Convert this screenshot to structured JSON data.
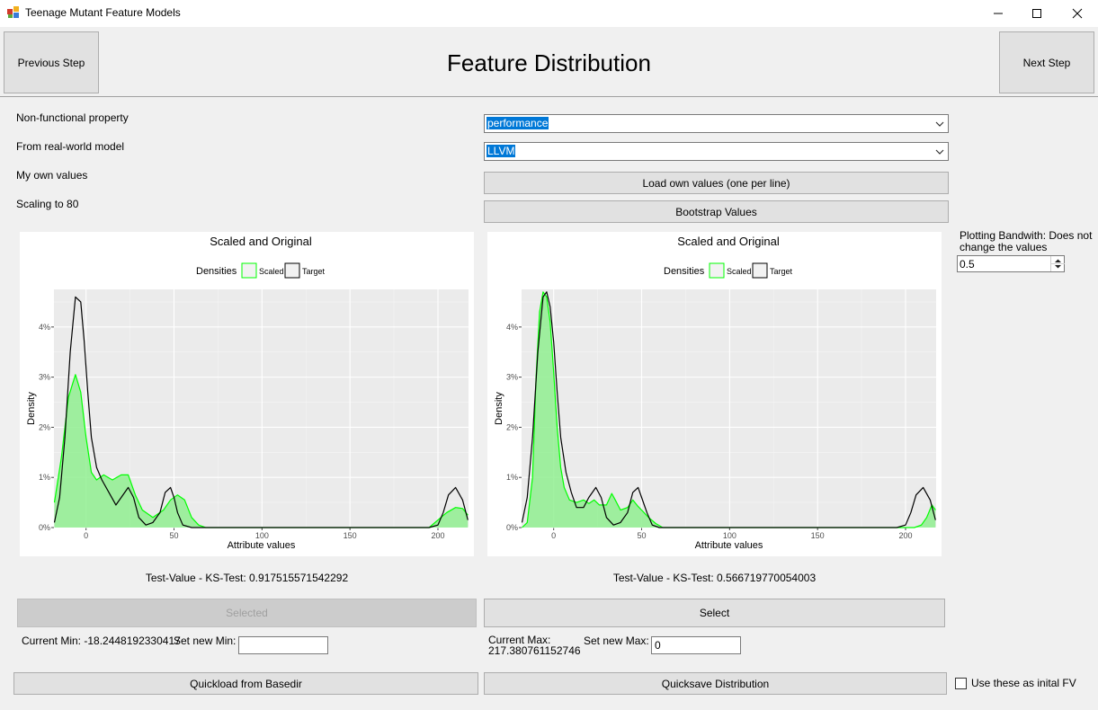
{
  "window": {
    "title": "Teenage Mutant Feature Models"
  },
  "header": {
    "title": "Feature Distribution",
    "prev_label": "Previous Step",
    "next_label": "Next Step"
  },
  "form": {
    "nfp_label": "Non-functional property",
    "nfp_value": "performance",
    "model_label": "From real-world model",
    "model_value": "LLVM",
    "own_values_label": "My own values",
    "load_button": "Load own values (one per line)",
    "scaling_label": "Scaling to 80",
    "bootstrap_button": "Bootstrap Values",
    "bandwidth_label_line1": "Plotting Bandwith: Does not",
    "bandwidth_label_line2": "change the values",
    "bandwidth_value": "0.5"
  },
  "left_panel": {
    "ks_text": "Test-Value - KS-Test: 0.917515571542292",
    "select_label": "Selected",
    "current_min": "Current Min: -18.2448192330417",
    "set_min_label": "Set new Min:",
    "set_min_value": "",
    "quickload": "Quickload from Basedir"
  },
  "right_panel": {
    "ks_text": "Test-Value - KS-Test: 0.566719770054003",
    "select_label": "Select",
    "current_max_line1": "Current Max:",
    "current_max_line2": "217.380761152746",
    "set_max_label": "Set new Max:",
    "set_max_value": "0",
    "quicksave": "Quicksave Distribution"
  },
  "use_initial": {
    "label": "Use these as inital FV",
    "checked": false
  },
  "colors": {
    "scaled_fill": "#90ee90",
    "scaled_line": "#00ff00",
    "target_line": "#000000",
    "plot_bg": "#ebebeb"
  },
  "chart_data": [
    {
      "type": "area",
      "title": "Scaled and Original",
      "legend_title": "Densities",
      "legend": [
        "Scaled",
        "Target"
      ],
      "xlabel": "Attribute values",
      "ylabel": "Density",
      "xlim": [
        -18.24,
        217.38
      ],
      "ylim": [
        0,
        0.0475
      ],
      "x_ticks": [
        0,
        50,
        100,
        150,
        200
      ],
      "y_ticks": [
        "0%",
        "1%",
        "2%",
        "3%",
        "4%"
      ],
      "series": [
        {
          "name": "Scaled",
          "x": [
            -18,
            -14,
            -10,
            -6,
            -3,
            0,
            3,
            6,
            10,
            15,
            20,
            24,
            28,
            32,
            38,
            44,
            48,
            52,
            56,
            60,
            64,
            68,
            80,
            100,
            150,
            195,
            200,
            205,
            210,
            214,
            217
          ],
          "y": [
            0.005,
            0.014,
            0.026,
            0.0305,
            0.027,
            0.018,
            0.011,
            0.0095,
            0.0105,
            0.0095,
            0.0105,
            0.0105,
            0.0065,
            0.0035,
            0.002,
            0.0035,
            0.0055,
            0.0065,
            0.0055,
            0.002,
            0.0005,
            0,
            0,
            0,
            0,
            0,
            0.0015,
            0.003,
            0.004,
            0.0038,
            0.0025
          ]
        },
        {
          "name": "Target",
          "x": [
            -18,
            -15,
            -12,
            -9,
            -6,
            -3,
            -1,
            1,
            3,
            6,
            9,
            13,
            17,
            20,
            24,
            27,
            30,
            34,
            38,
            42,
            45,
            48,
            50,
            52,
            55,
            60,
            70,
            100,
            150,
            195,
            200,
            203,
            206,
            210,
            214,
            217
          ],
          "y": [
            0.001,
            0.006,
            0.018,
            0.035,
            0.046,
            0.045,
            0.037,
            0.027,
            0.018,
            0.012,
            0.0095,
            0.007,
            0.0045,
            0.006,
            0.008,
            0.006,
            0.002,
            0.0005,
            0.001,
            0.003,
            0.007,
            0.008,
            0.006,
            0.003,
            0.0005,
            0,
            0,
            0,
            0,
            0,
            0.0005,
            0.003,
            0.0065,
            0.008,
            0.0055,
            0.0015
          ]
        }
      ]
    },
    {
      "type": "area",
      "title": "Scaled and Original",
      "legend_title": "Densities",
      "legend": [
        "Scaled",
        "Target"
      ],
      "xlabel": "Attribute values",
      "ylabel": "Density",
      "xlim": [
        -18.24,
        217.38
      ],
      "ylim": [
        0,
        0.0475
      ],
      "x_ticks": [
        0,
        50,
        100,
        150,
        200
      ],
      "y_ticks": [
        "0%",
        "1%",
        "2%",
        "3%",
        "4%"
      ],
      "series": [
        {
          "name": "Scaled",
          "x": [
            -18,
            -15,
            -12,
            -10,
            -8,
            -6,
            -4,
            -2,
            0,
            2,
            4,
            6,
            9,
            13,
            17,
            20,
            23,
            26,
            30,
            33,
            35,
            38,
            42,
            45,
            48,
            50,
            54,
            58,
            62,
            70,
            100,
            150,
            200,
            205,
            209,
            212,
            215,
            217
          ],
          "y": [
            0,
            0.001,
            0.01,
            0.03,
            0.043,
            0.047,
            0.046,
            0.041,
            0.031,
            0.02,
            0.012,
            0.008,
            0.0055,
            0.005,
            0.0055,
            0.0048,
            0.0055,
            0.0045,
            0.0045,
            0.0068,
            0.0055,
            0.0035,
            0.004,
            0.0055,
            0.0042,
            0.0035,
            0.002,
            0.0008,
            0,
            0,
            0,
            0,
            0,
            0,
            0.0005,
            0.002,
            0.0045,
            0.0035
          ]
        },
        {
          "name": "Target",
          "x": [
            -18,
            -15,
            -12,
            -9,
            -6,
            -4,
            -2,
            0,
            2,
            4,
            7,
            10,
            13,
            17,
            20,
            24,
            27,
            30,
            34,
            38,
            42,
            45,
            48,
            50,
            53,
            56,
            60,
            70,
            100,
            150,
            195,
            200,
            203,
            206,
            210,
            214,
            217
          ],
          "y": [
            0.001,
            0.006,
            0.018,
            0.035,
            0.046,
            0.047,
            0.044,
            0.037,
            0.027,
            0.018,
            0.011,
            0.007,
            0.004,
            0.004,
            0.006,
            0.008,
            0.006,
            0.002,
            0.0005,
            0.001,
            0.003,
            0.007,
            0.008,
            0.006,
            0.003,
            0.0005,
            0,
            0,
            0,
            0,
            0,
            0.0005,
            0.003,
            0.0065,
            0.008,
            0.0055,
            0.0015
          ]
        }
      ]
    }
  ]
}
